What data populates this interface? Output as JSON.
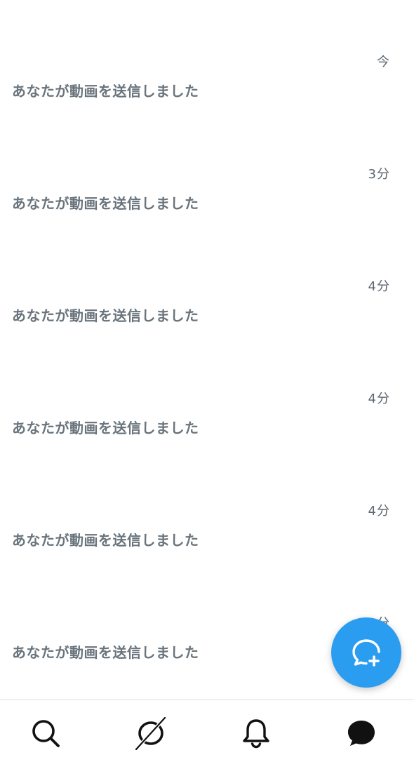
{
  "conversations": [
    {
      "time": "今",
      "preview": "あなたが動画を送信しました"
    },
    {
      "time": "3分",
      "preview": "あなたが動画を送信しました"
    },
    {
      "time": "4分",
      "preview": "あなたが動画を送信しました"
    },
    {
      "time": "4分",
      "preview": "あなたが動画を送信しました"
    },
    {
      "time": "4分",
      "preview": "あなたが動画を送信しました"
    },
    {
      "time": "8分",
      "preview": "あなたが動画を送信しました"
    }
  ],
  "fab": {
    "icon": "new-message-icon",
    "color": "#2a9df0"
  },
  "tabbar": {
    "items": [
      {
        "icon": "search-icon",
        "active": false
      },
      {
        "icon": "no-signal-icon",
        "active": false
      },
      {
        "icon": "bell-icon",
        "active": false
      },
      {
        "icon": "messages-icon",
        "active": true
      }
    ]
  }
}
